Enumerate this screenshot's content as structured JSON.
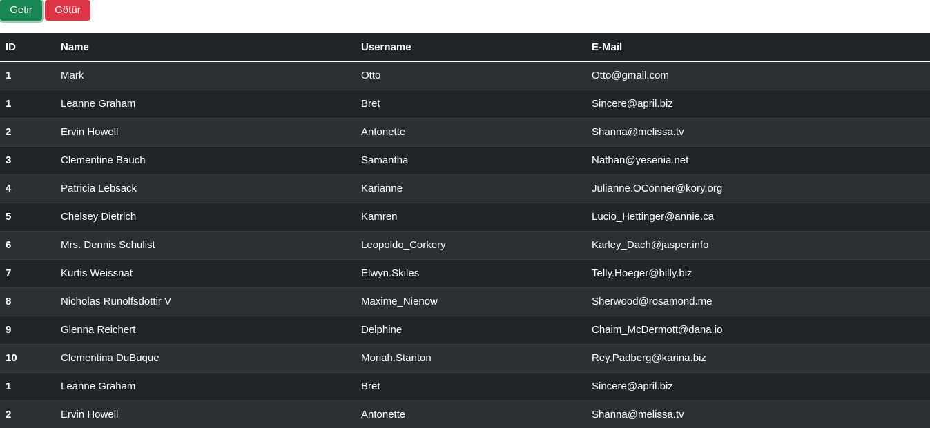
{
  "toolbar": {
    "getir_label": "Getir",
    "gotur_label": "Götür",
    "getir_color": "#198754",
    "gotur_color": "#dc3545"
  },
  "table": {
    "headers": [
      "ID",
      "Name",
      "Username",
      "E-Mail"
    ],
    "rows": [
      {
        "id": "1",
        "name": "Mark",
        "username": "Otto",
        "email": "Otto@gmail.com"
      },
      {
        "id": "1",
        "name": "Leanne Graham",
        "username": "Bret",
        "email": "Sincere@april.biz"
      },
      {
        "id": "2",
        "name": "Ervin Howell",
        "username": "Antonette",
        "email": "Shanna@melissa.tv"
      },
      {
        "id": "3",
        "name": "Clementine Bauch",
        "username": "Samantha",
        "email": "Nathan@yesenia.net"
      },
      {
        "id": "4",
        "name": "Patricia Lebsack",
        "username": "Karianne",
        "email": "Julianne.OConner@kory.org"
      },
      {
        "id": "5",
        "name": "Chelsey Dietrich",
        "username": "Kamren",
        "email": "Lucio_Hettinger@annie.ca"
      },
      {
        "id": "6",
        "name": "Mrs. Dennis Schulist",
        "username": "Leopoldo_Corkery",
        "email": "Karley_Dach@jasper.info"
      },
      {
        "id": "7",
        "name": "Kurtis Weissnat",
        "username": "Elwyn.Skiles",
        "email": "Telly.Hoeger@billy.biz"
      },
      {
        "id": "8",
        "name": "Nicholas Runolfsdottir V",
        "username": "Maxime_Nienow",
        "email": "Sherwood@rosamond.me"
      },
      {
        "id": "9",
        "name": "Glenna Reichert",
        "username": "Delphine",
        "email": "Chaim_McDermott@dana.io"
      },
      {
        "id": "10",
        "name": "Clementina DuBuque",
        "username": "Moriah.Stanton",
        "email": "Rey.Padberg@karina.biz"
      },
      {
        "id": "1",
        "name": "Leanne Graham",
        "username": "Bret",
        "email": "Sincere@april.biz"
      },
      {
        "id": "2",
        "name": "Ervin Howell",
        "username": "Antonette",
        "email": "Shanna@melissa.tv"
      }
    ]
  }
}
